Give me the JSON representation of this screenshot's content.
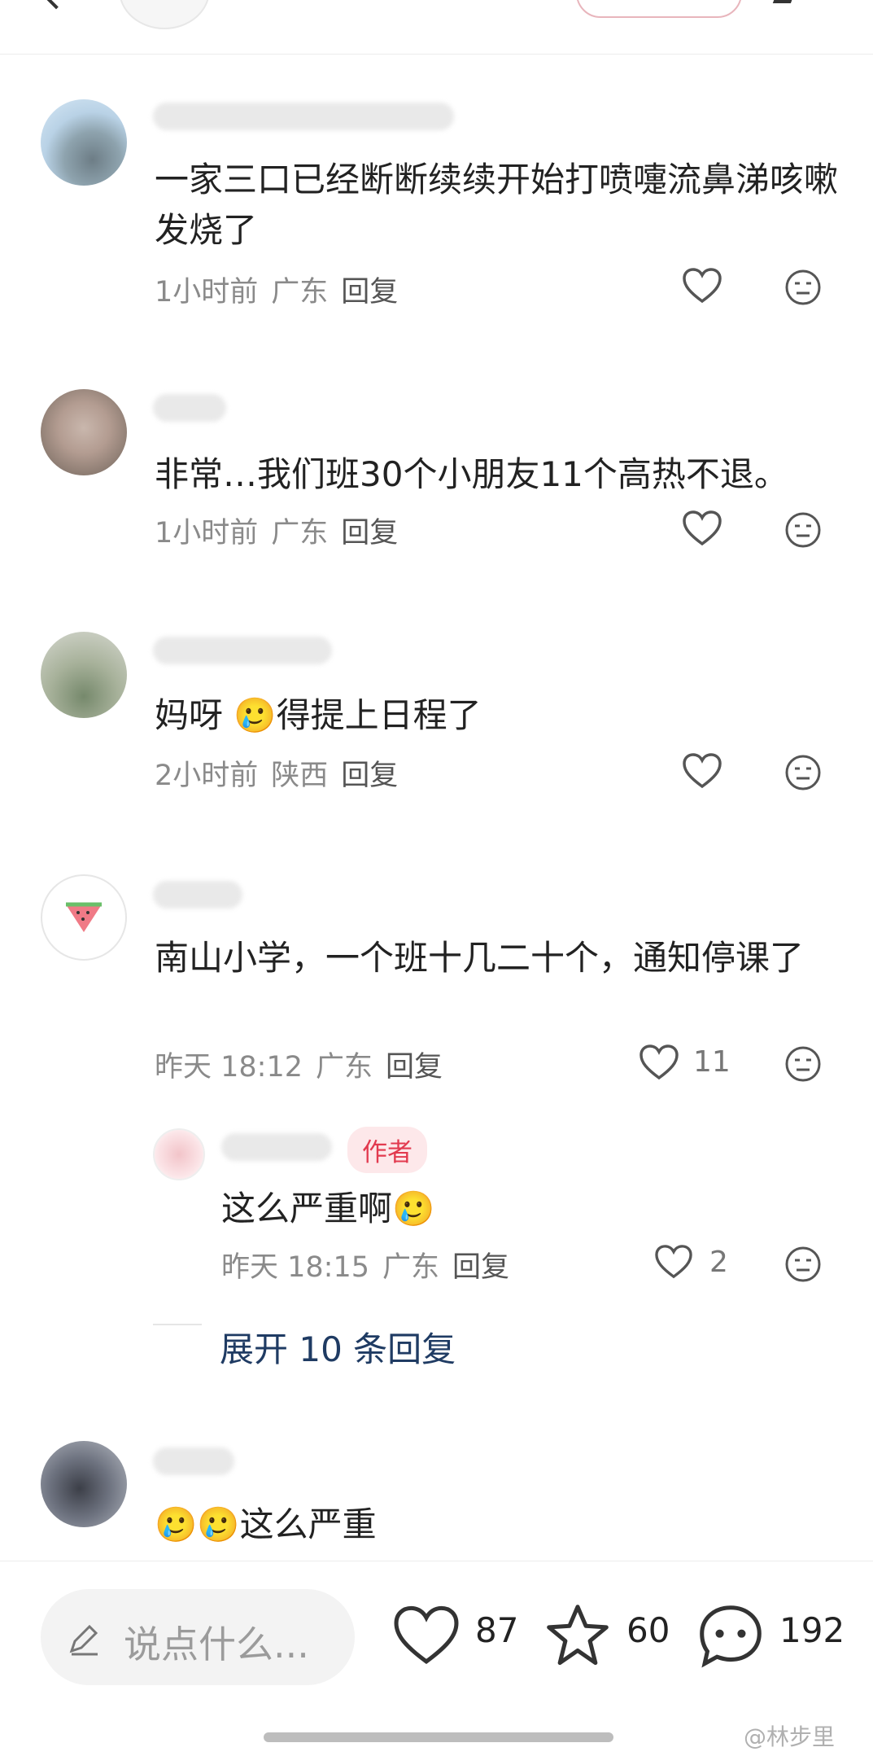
{
  "comments": [
    {
      "text": "一家三口已经断断续续开始打喷嚏流鼻涕咳嗽发烧了",
      "time": "1小时前",
      "location": "广东",
      "reply": "回复",
      "likes": ""
    },
    {
      "text": "非常…我们班30个小朋友11个高热不退。",
      "time": "1小时前",
      "location": "广东",
      "reply": "回复",
      "likes": ""
    },
    {
      "text": "妈呀 🥲得提上日程了",
      "time": "2小时前",
      "location": "陕西",
      "reply": "回复",
      "likes": ""
    },
    {
      "text": "南山小学，一个班十几二十个，通知停课了",
      "time": "昨天 18:12",
      "location": "广东",
      "reply": "回复",
      "likes": "11"
    },
    {
      "text": "🥲🥲这么严重",
      "time": "",
      "location": "",
      "reply": "",
      "likes": ""
    }
  ],
  "sub_reply": {
    "tag": "作者",
    "text": "这么严重啊🥲",
    "time": "昨天 18:15",
    "location": "广东",
    "reply": "回复",
    "likes": "2"
  },
  "expand_label": "展开 10 条回复",
  "bottom": {
    "placeholder": "说点什么...",
    "likes": "87",
    "stars": "60",
    "comments": "192"
  },
  "watermark": "@林步里",
  "colors": {
    "author_tag": "#e23a4f",
    "expand_link": "#1f3b63",
    "meta": "#8a8a8a"
  },
  "icons": [
    "heart-icon",
    "neutral-face-icon",
    "star-icon",
    "chat-bubble-icon",
    "pencil-icon",
    "watermelon-icon"
  ]
}
